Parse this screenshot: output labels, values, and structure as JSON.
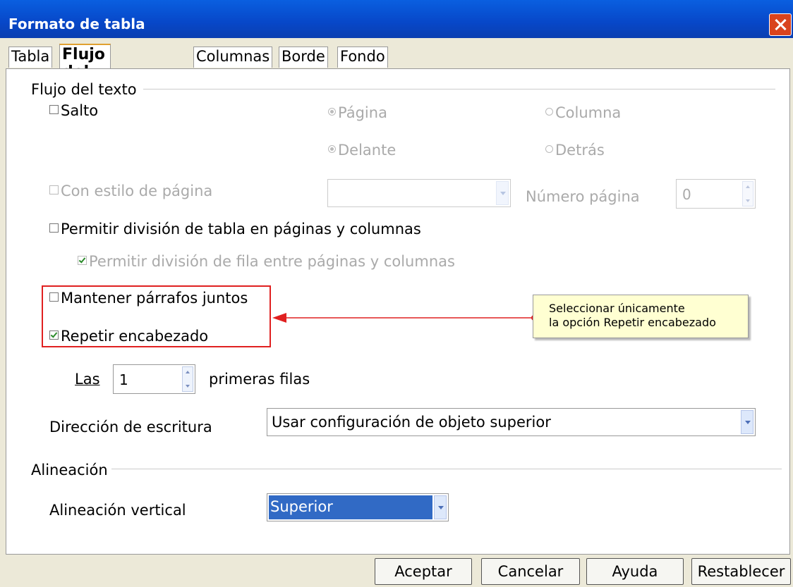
{
  "window": {
    "title": "Formato de tabla"
  },
  "tabs": [
    "Tabla",
    "Flujo del texto",
    "Columnas",
    "Borde",
    "Fondo"
  ],
  "flow": {
    "section": "Flujo del texto",
    "salto": {
      "label": "Salto",
      "checked": false
    },
    "pagina": "Página",
    "columna": "Columna",
    "delante": "Delante",
    "detras": "Detrás",
    "con_estilo": "Con estilo de página",
    "numero_pagina": "Número página",
    "numero_value": "0",
    "permitir_tabla": "Permitir división de tabla en páginas y columnas",
    "permitir_fila": "Permitir división de fila entre páginas y columnas",
    "mantener": "Mantener párrafos juntos",
    "repetir": "Repetir encabezado",
    "las": "Las",
    "las_value": "1",
    "primeras": "primeras filas",
    "direccion_label": "Dirección de escritura",
    "direccion_value": "Usar configuración de objeto superior"
  },
  "alignment": {
    "section": "Alineación",
    "vertical_label": "Alineación vertical",
    "vertical_value": "Superior"
  },
  "callout": {
    "line1": "Seleccionar únicamente",
    "line2": "la opción Repetir encabezado"
  },
  "buttons": {
    "ok": "Aceptar",
    "cancel": "Cancelar",
    "help": "Ayuda",
    "reset": "Restablecer"
  },
  "colors": {
    "title_bar": "#0747c8",
    "annotation": "#e02020",
    "selection": "#316ac5"
  }
}
